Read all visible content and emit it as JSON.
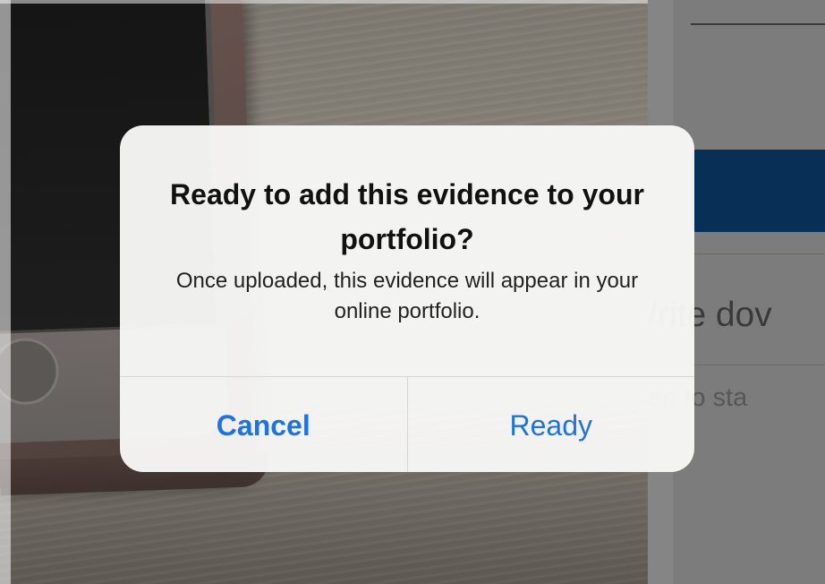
{
  "alert": {
    "title": "Ready to add this evidence to your portfolio?",
    "message": "Once uploaded, this evidence will appear in your online portfolio.",
    "cancel_label": "Cancel",
    "confirm_label": "Ready"
  },
  "background_panel": {
    "heading_fragment": "/rite dov",
    "hint_fragment": "ap to sta"
  },
  "colors": {
    "action_blue": "#1a73e8",
    "dialog_background": "#f8f8f7",
    "panel_button_blue": "#082f56"
  }
}
